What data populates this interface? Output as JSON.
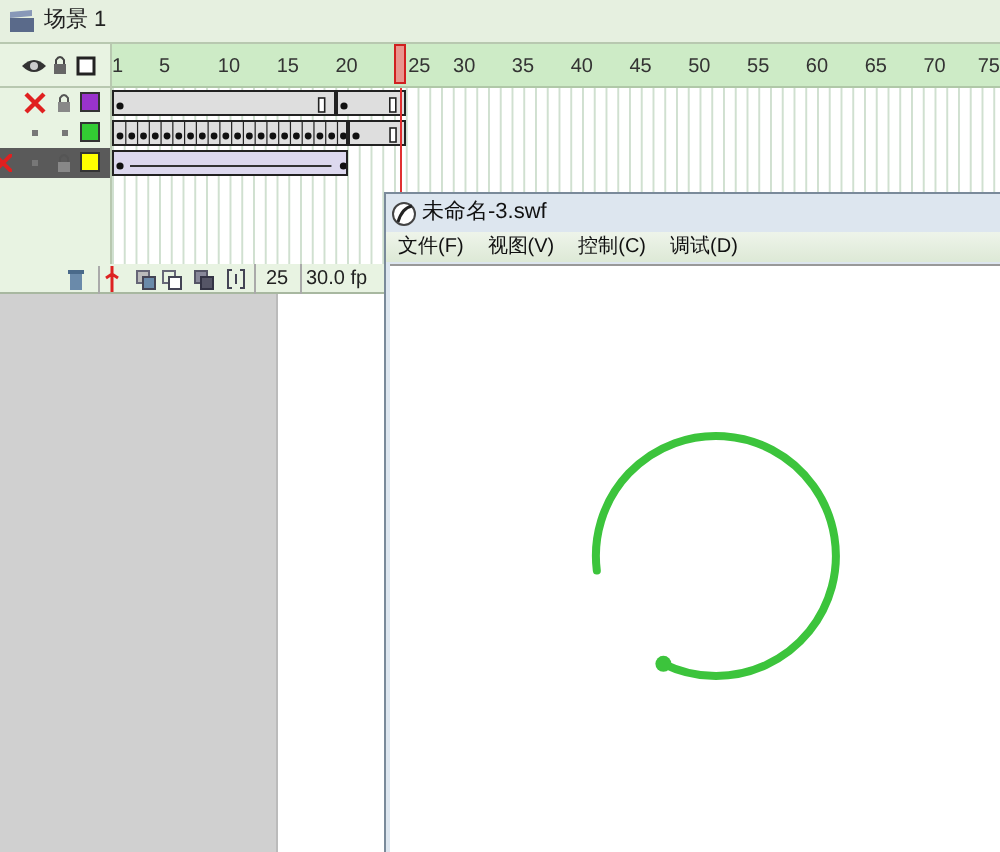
{
  "scene": {
    "title": "场景 1"
  },
  "timeline": {
    "ruler": [
      "1",
      "5",
      "10",
      "15",
      "20",
      "25",
      "30",
      "35",
      "40",
      "45",
      "50",
      "55",
      "60",
      "65",
      "70",
      "75"
    ],
    "layers": [
      {
        "hidden": true,
        "locked": true,
        "color": "#9933cc",
        "selected": false,
        "editable": true
      },
      {
        "hidden": false,
        "locked": false,
        "color": "#33cc33",
        "selected": false,
        "editable": true
      },
      {
        "hidden": false,
        "locked": true,
        "color": "#ffff00",
        "selected": true,
        "editable": false
      }
    ],
    "toolbar": {
      "current_frame": "25",
      "frame_rate": "30.0 fp"
    }
  },
  "player": {
    "title": "未命名-3.swf",
    "menu": [
      "文件(F)",
      "视图(V)",
      "控制(C)",
      "调试(D)"
    ]
  }
}
